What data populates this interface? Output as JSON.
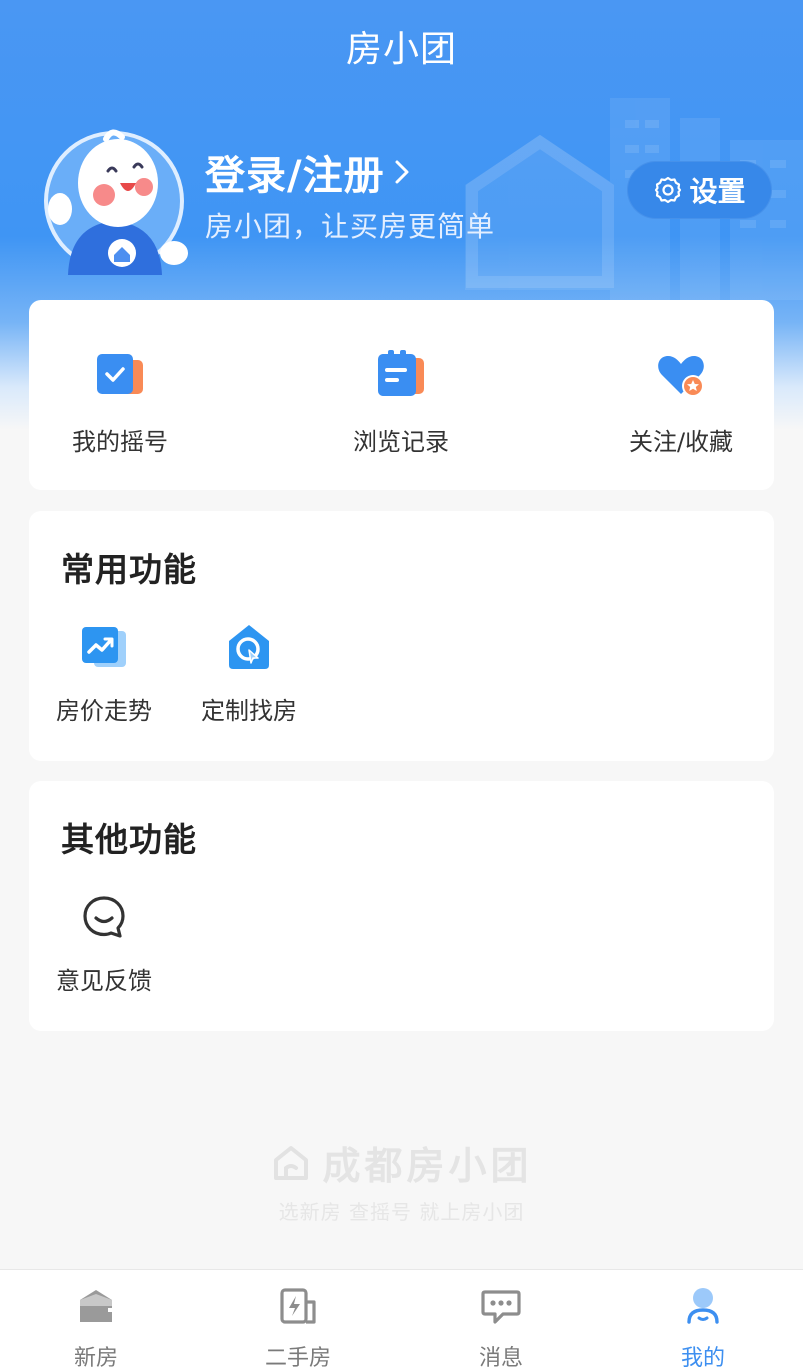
{
  "header": {
    "app_title": "房小团",
    "login_label": "登录/注册",
    "subtitle": "房小团，让买房更简单",
    "settings_label": "设置"
  },
  "quick_actions": [
    {
      "label": "我的摇号",
      "icon": "lottery-check-icon"
    },
    {
      "label": "浏览记录",
      "icon": "history-clipboard-icon"
    },
    {
      "label": "关注/收藏",
      "icon": "heart-star-icon"
    }
  ],
  "common_functions": {
    "title": "常用功能",
    "items": [
      {
        "label": "房价走势",
        "icon": "trend-chart-icon"
      },
      {
        "label": "定制找房",
        "icon": "custom-house-search-icon"
      }
    ]
  },
  "other_functions": {
    "title": "其他功能",
    "items": [
      {
        "label": "意见反馈",
        "icon": "feedback-chat-icon"
      }
    ]
  },
  "watermark": {
    "brand": "成都房小团",
    "slogan": "选新房 查摇号 就上房小团"
  },
  "tabbar": {
    "active": "我的",
    "tabs": [
      {
        "label": "新房",
        "icon": "new-house-icon"
      },
      {
        "label": "二手房",
        "icon": "second-hand-house-icon"
      },
      {
        "label": "消息",
        "icon": "message-icon"
      },
      {
        "label": "我的",
        "icon": "profile-icon"
      }
    ]
  },
  "colors": {
    "brand_blue": "#4a97f3",
    "active_tab": "#3d8ff0",
    "accent_orange": "#f98a56"
  }
}
